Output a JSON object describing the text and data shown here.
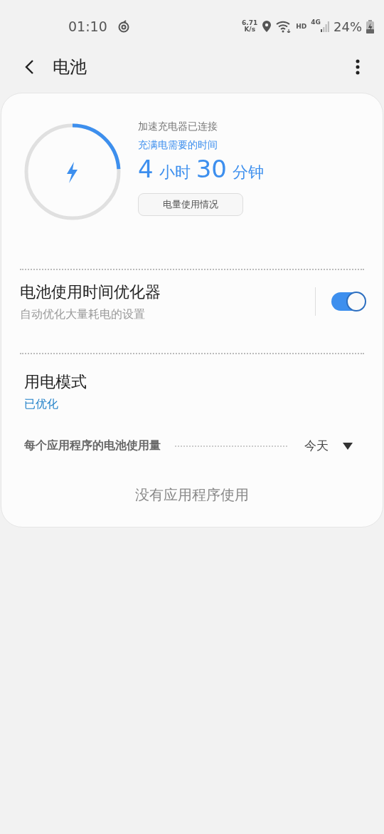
{
  "status_bar": {
    "time": "01:10",
    "speed_value": "6.71",
    "speed_unit": "K/s",
    "hd": "HD",
    "network": "4G",
    "battery": "24%"
  },
  "header": {
    "title": "电池"
  },
  "charging": {
    "level": 0.24,
    "status": "加速充电器已连接",
    "label": "充满电需要的时间",
    "hours": "4",
    "hours_unit": "小时",
    "minutes": "30",
    "minutes_unit": "分钟",
    "button": "电量使用情况"
  },
  "optimizer": {
    "title": "电池使用时间优化器",
    "subtitle": "自动优化大量耗电的设置",
    "on": true
  },
  "power_mode": {
    "title": "用电模式",
    "value": "已优化"
  },
  "app_usage": {
    "label": "每个应用程序的电池使用量",
    "period": "今天",
    "empty": "没有应用程序使用"
  }
}
